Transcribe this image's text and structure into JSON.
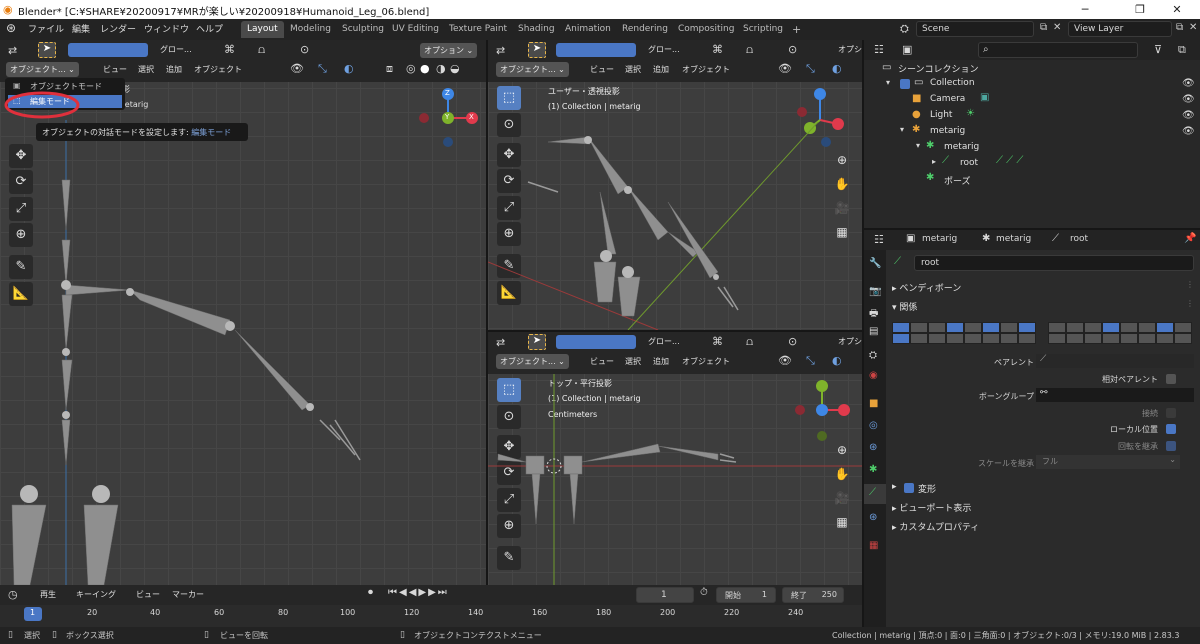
{
  "window": {
    "title": "Blender* [C:¥SHARE¥20200917¥MRが楽しい¥20200918¥Humanoid_Leg_06.blend]",
    "min": "─",
    "max": "❐",
    "close": "✕"
  },
  "menus": [
    "ファイル",
    "編集",
    "レンダー",
    "ウィンドウ",
    "ヘルプ"
  ],
  "workspaces": [
    "Layout",
    "Modeling",
    "Sculpting",
    "UV Editing",
    "Texture Paint",
    "Shading",
    "Animation",
    "Rendering",
    "Compositing",
    "Scripting"
  ],
  "add_tab": "+",
  "scene": {
    "name": "Scene",
    "view_layer": "View Layer"
  },
  "left_viewport": {
    "transform": "グロー...",
    "options": "オプション",
    "mode": "オブジェクト...",
    "menu": [
      "ビュー",
      "選択",
      "追加",
      "オブジェクト"
    ],
    "dropdown_items": [
      "オブジェクトモード",
      "編集モード"
    ],
    "tooltip": {
      "text": "オブジェクトの対話モードを設定します:",
      "value": "編集モード"
    },
    "partial_text_1": "影",
    "partial_text_2": "metarig"
  },
  "right_top_viewport": {
    "transform": "グロー...",
    "options": "オプシ",
    "mode": "オブジェクト...",
    "menu": [
      "ビュー",
      "選択",
      "追加",
      "オブジェクト"
    ],
    "info_title": "ユーザー・透視投影",
    "info_sub": "(1) Collection | metarig"
  },
  "right_bottom_viewport": {
    "transform": "グロー...",
    "options": "オプシ",
    "mode": "オブジェクト...",
    "menu": [
      "ビュー",
      "選択",
      "追加",
      "オブジェクト"
    ],
    "info_title": "トップ・平行投影",
    "info_sub": "(1) Collection | metarig",
    "info_units": "Centimeters"
  },
  "gizmo": {
    "x": "X",
    "y": "Y",
    "z": "Z",
    "colors": {
      "x": "#e03a4c",
      "y": "#7fb32b",
      "z": "#3e87e6"
    }
  },
  "outliner": {
    "title": "シーンコレクション",
    "rows": [
      {
        "label": "Collection"
      },
      {
        "label": "Camera"
      },
      {
        "label": "Light"
      },
      {
        "label": "metarig"
      },
      {
        "label": "metarig"
      },
      {
        "label": "root"
      },
      {
        "label": "ポーズ"
      }
    ]
  },
  "properties": {
    "breadcrumb": [
      "metarig",
      "metarig",
      "root"
    ],
    "bone_name": "root",
    "sections": {
      "bendy": "ベンディボーン",
      "relations": "関係",
      "transform": "変形",
      "viewport": "ビューポート表示",
      "custom": "カスタムプロパティ"
    },
    "fields": {
      "parent": "ペアレント",
      "relative_parent": "相対ペアレント",
      "bone_group": "ボーングループ",
      "connected": "接続",
      "local_location": "ローカル位置",
      "inherit_rotation": "回転を継承",
      "inherit_scale": "スケールを継承",
      "inherit_scale_value": "フル"
    }
  },
  "timeline": {
    "menu": [
      "再生",
      "キーイング",
      "ビュー",
      "マーカー"
    ],
    "current_frame": "1",
    "start_label": "開始",
    "start": "1",
    "end_label": "終了",
    "end": "250",
    "ruler": [
      "1",
      "20",
      "40",
      "60",
      "80",
      "100",
      "120",
      "140",
      "160",
      "180",
      "200",
      "220",
      "240"
    ]
  },
  "status": {
    "select": "選択",
    "box_select": "ボックス選択",
    "rotate_view": "ビューを回転",
    "context_menu": "オブジェクトコンテクストメニュー",
    "info": "Collection | metarig | 頂点:0 | 面:0 | 三角面:0 | オブジェクト:0/3 | メモリ:19.0 MiB | 2.83.3"
  },
  "colors": {
    "accent": "#4a77c5",
    "selection": "#e0303c",
    "bone": "#8f8f8f"
  }
}
